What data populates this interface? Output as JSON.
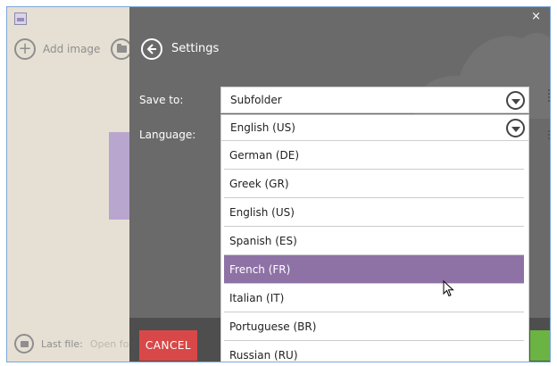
{
  "app": {
    "add_image_label": "Add image",
    "last_file_label": "Last file:",
    "open_folder_label": "Open fo"
  },
  "settings": {
    "title": "Settings",
    "close_glyph": "×",
    "save_to": {
      "label": "Save to:",
      "value": "Subfolder"
    },
    "language": {
      "label": "Language:",
      "value": "English (US)",
      "options": [
        "German (DE)",
        "Greek (GR)",
        "English (US)",
        "Spanish (ES)",
        "French (FR)",
        "Italian (IT)",
        "Portuguese (BR)",
        "Russian (RU)"
      ],
      "highlighted": "French (FR)"
    },
    "cancel_label": "CANCEL"
  },
  "colors": {
    "panel_bg": "#6a6a6a",
    "highlight": "#8e72a6",
    "cancel": "#d84848",
    "save": "#6bb342",
    "app_bg": "#e6e0d4"
  }
}
